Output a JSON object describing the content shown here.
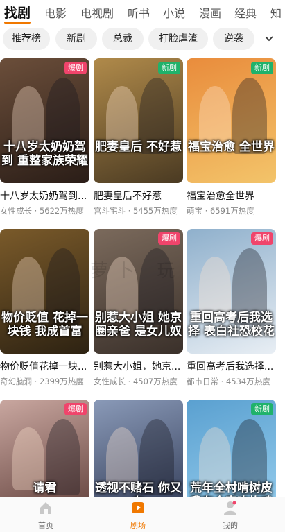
{
  "top_tabs": [
    "找剧",
    "电影",
    "电视剧",
    "听书",
    "小说",
    "漫画",
    "经典",
    "知"
  ],
  "chips": [
    "推荐榜",
    "新剧",
    "总裁",
    "打脸虐渣",
    "逆袭"
  ],
  "cards": [
    {
      "title": "十八岁太奶奶驾到...",
      "meta": "女性成长 · 5622万热度",
      "badge": "爆剧",
      "badge_type": "hot",
      "poster_text": "十八岁太奶奶驾到 重整家族荣耀",
      "bg": [
        "#6b4e3a",
        "#2a1d17"
      ]
    },
    {
      "title": "肥妻皇后不好惹",
      "meta": "宫斗宅斗 · 5455万热度",
      "badge": "新剧",
      "badge_type": "new",
      "poster_text": "肥妻皇后 不好惹",
      "bg": [
        "#b08a4a",
        "#4a3a22"
      ]
    },
    {
      "title": "福宝治愈全世界",
      "meta": "萌宝 · 6591万热度",
      "badge": "新剧",
      "badge_type": "new",
      "poster_text": "福宝治愈 全世界",
      "bg": [
        "#e98c3c",
        "#f3c46a"
      ]
    },
    {
      "title": "物价贬值花掉一块...",
      "meta": "奇幻脑洞 · 2399万热度",
      "badge": "",
      "badge_type": "",
      "poster_text": "物价贬值 花掉一块钱 我成首富",
      "bg": [
        "#7a5a2a",
        "#2d2212"
      ]
    },
    {
      "title": "别惹大小姐，她京...",
      "meta": "女性成长 · 4507万热度",
      "badge": "爆剧",
      "badge_type": "hot",
      "poster_text": "别惹大小姐 她京圈亲爸 是女儿奴",
      "bg": [
        "#7b6a5c",
        "#3a302a"
      ]
    },
    {
      "title": "重回高考后我选择...",
      "meta": "都市日常 · 4534万热度",
      "badge": "爆剧",
      "badge_type": "hot",
      "poster_text": "重回高考后我选择 表白社恐校花",
      "bg": [
        "#8fb0cc",
        "#e8eef4"
      ]
    },
    {
      "title": "",
      "meta": "",
      "badge": "爆剧",
      "badge_type": "hot",
      "poster_text": "请君",
      "bg": [
        "#c9a7a0",
        "#5b3a35"
      ]
    },
    {
      "title": "",
      "meta": "",
      "badge": "",
      "badge_type": "",
      "poster_text": "透视不赌石 你又在",
      "bg": [
        "#8a9ab8",
        "#2c3550"
      ]
    },
    {
      "title": "",
      "meta": "",
      "badge": "新剧",
      "badge_type": "new",
      "poster_text": "荒年全村啃树皮 我有全家吃炸鸡",
      "bg": [
        "#5aa0d0",
        "#9ad0ef"
      ]
    }
  ],
  "watermark": "萝卜 玩",
  "bottom_nav": [
    {
      "label": "首页",
      "icon": "home-icon",
      "active": false
    },
    {
      "label": "剧场",
      "icon": "theater-icon",
      "active": true
    },
    {
      "label": "我的",
      "icon": "profile-icon",
      "active": false
    }
  ],
  "colors": {
    "accent": "#f07800",
    "hot_badge": "#f0446b",
    "new_badge": "#20b26b"
  }
}
